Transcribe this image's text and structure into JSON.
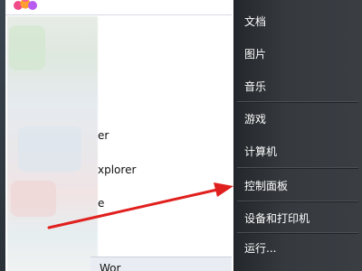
{
  "start_menu": {
    "left_list": {
      "items": [
        {
          "label": "er"
        },
        {
          "label": "xplorer"
        },
        {
          "label": "e"
        },
        {
          "label": "Wor"
        }
      ]
    },
    "right_list": {
      "items": [
        {
          "label": "文档"
        },
        {
          "label": "图片"
        },
        {
          "label": "音乐"
        },
        {
          "label": "游戏"
        },
        {
          "label": "计算机"
        },
        {
          "label": "控制面板"
        },
        {
          "label": "设备和打印机"
        },
        {
          "label": "运行..."
        }
      ]
    }
  },
  "annotation": {
    "arrow_color": "#e0201e",
    "arrow_target": "控制面板"
  },
  "colors": {
    "right_panel_bg": "#363a3f",
    "left_panel_bg": "#ffffff",
    "menu_text": "#ffffff"
  },
  "icons": {
    "logo": "windows-orb-icon"
  }
}
